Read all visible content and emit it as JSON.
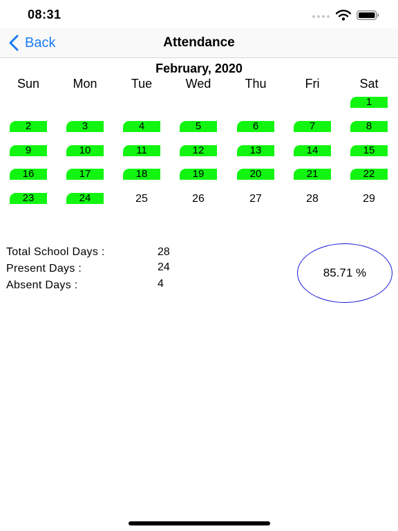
{
  "status_bar": {
    "time": "08:31"
  },
  "nav": {
    "back_label": "Back",
    "title": "Attendance"
  },
  "calendar": {
    "month_title": "February, 2020",
    "weekdays": [
      "Sun",
      "Mon",
      "Tue",
      "Wed",
      "Thu",
      "Fri",
      "Sat"
    ],
    "present_color": "#11f511",
    "days": [
      {
        "day": "1",
        "present": true
      },
      {
        "day": "2",
        "present": true
      },
      {
        "day": "3",
        "present": true
      },
      {
        "day": "4",
        "present": true
      },
      {
        "day": "5",
        "present": true
      },
      {
        "day": "6",
        "present": true
      },
      {
        "day": "7",
        "present": true
      },
      {
        "day": "8",
        "present": true
      },
      {
        "day": "9",
        "present": true
      },
      {
        "day": "10",
        "present": true
      },
      {
        "day": "11",
        "present": true
      },
      {
        "day": "12",
        "present": true
      },
      {
        "day": "13",
        "present": true
      },
      {
        "day": "14",
        "present": true
      },
      {
        "day": "15",
        "present": true
      },
      {
        "day": "16",
        "present": true
      },
      {
        "day": "17",
        "present": true
      },
      {
        "day": "18",
        "present": true
      },
      {
        "day": "19",
        "present": true
      },
      {
        "day": "20",
        "present": true
      },
      {
        "day": "21",
        "present": true
      },
      {
        "day": "22",
        "present": true
      },
      {
        "day": "23",
        "present": true
      },
      {
        "day": "24",
        "present": true
      },
      {
        "day": "25",
        "present": false
      },
      {
        "day": "26",
        "present": false
      },
      {
        "day": "27",
        "present": false
      },
      {
        "day": "28",
        "present": false
      },
      {
        "day": "29",
        "present": false
      }
    ]
  },
  "summary": {
    "total_label": "Total School Days :",
    "total_value": "28",
    "present_label": "Present Days :",
    "present_value": "24",
    "absent_label": "Absent Days :",
    "absent_value": "4",
    "percentage": "85.71 %"
  },
  "colors": {
    "accent": "#1a7cf5",
    "circle_border": "#1616d8"
  }
}
